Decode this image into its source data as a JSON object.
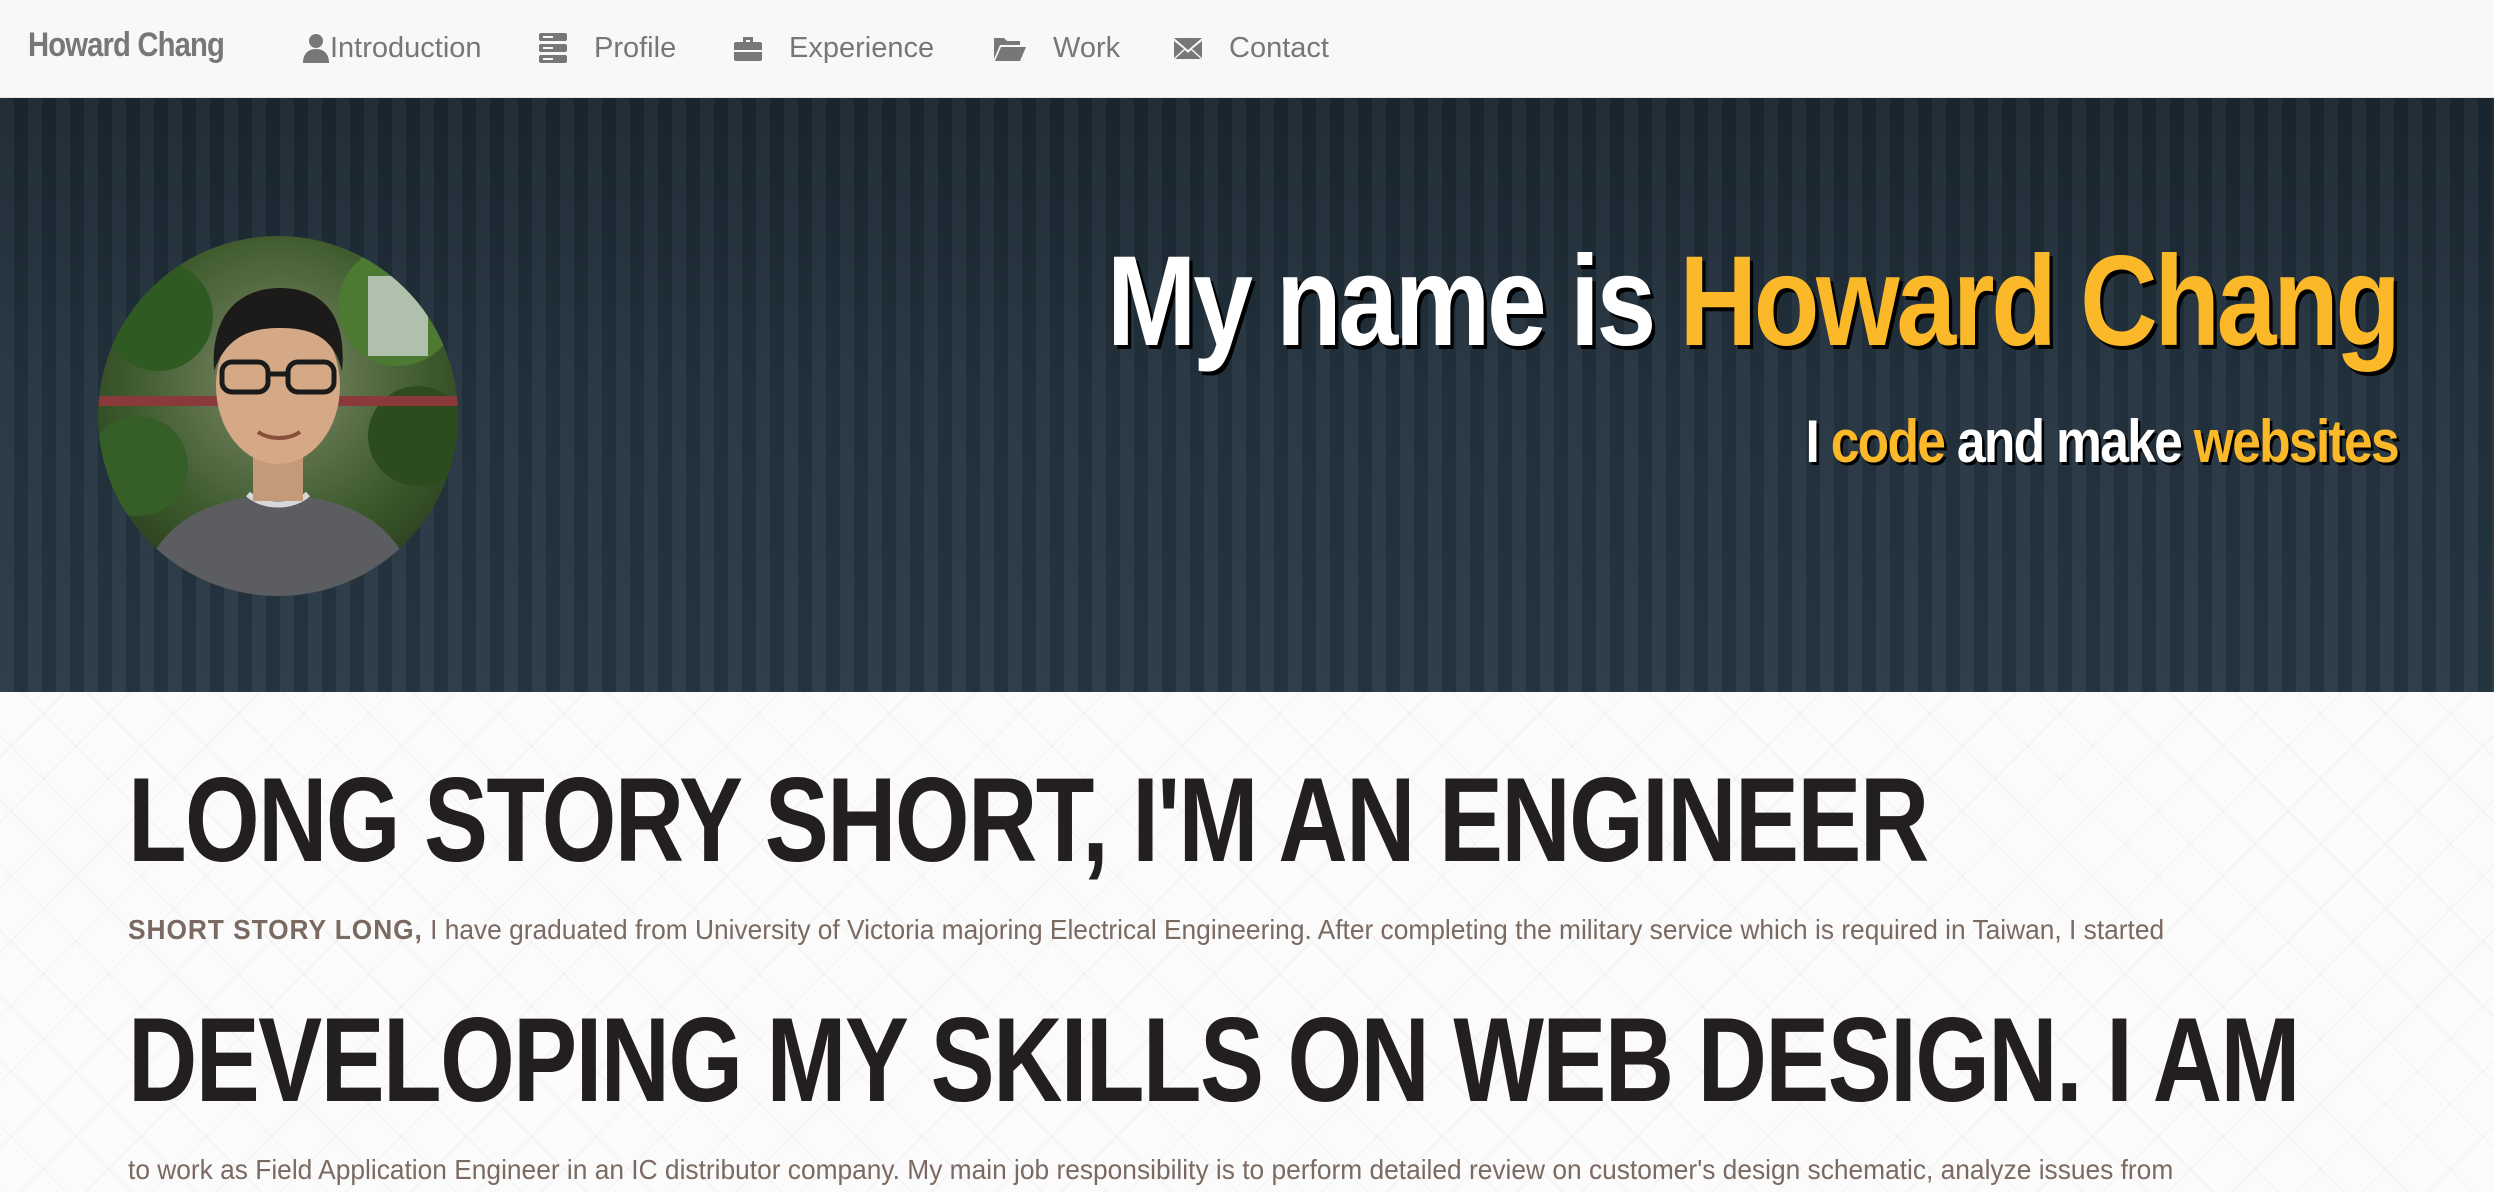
{
  "navbar": {
    "brand": "Howard Chang",
    "items": [
      {
        "label": "Introduction",
        "icon": "user-icon"
      },
      {
        "label": "Profile",
        "icon": "server-icon"
      },
      {
        "label": "Experience",
        "icon": "briefcase-icon"
      },
      {
        "label": "Work",
        "icon": "folder-open-icon"
      },
      {
        "label": "Contact",
        "icon": "envelope-icon"
      }
    ]
  },
  "hero": {
    "title_prefix": "My name is ",
    "title_name": "Howard Chang",
    "sub_i": "I ",
    "sub_code": "code",
    "sub_and_make": " and make ",
    "sub_websites": "websites",
    "accent_color": "#fbb829"
  },
  "content": {
    "heading1": "LONG STORY SHORT, I'M AN ENGINEER",
    "para1_lead": "SHORT STORY LONG,",
    "para1_text": " I have graduated from University of Victoria majoring Electrical Engineering. After completing the military service which is required in Taiwan, I started",
    "heading2": "DEVELOPING MY SKILLS ON WEB DESIGN. I AM",
    "para2_text": "to work as Field Application Engineer in an IC distributor company. My main job responsibility is to perform detailed review on customer's design schematic, analyze issues from"
  }
}
